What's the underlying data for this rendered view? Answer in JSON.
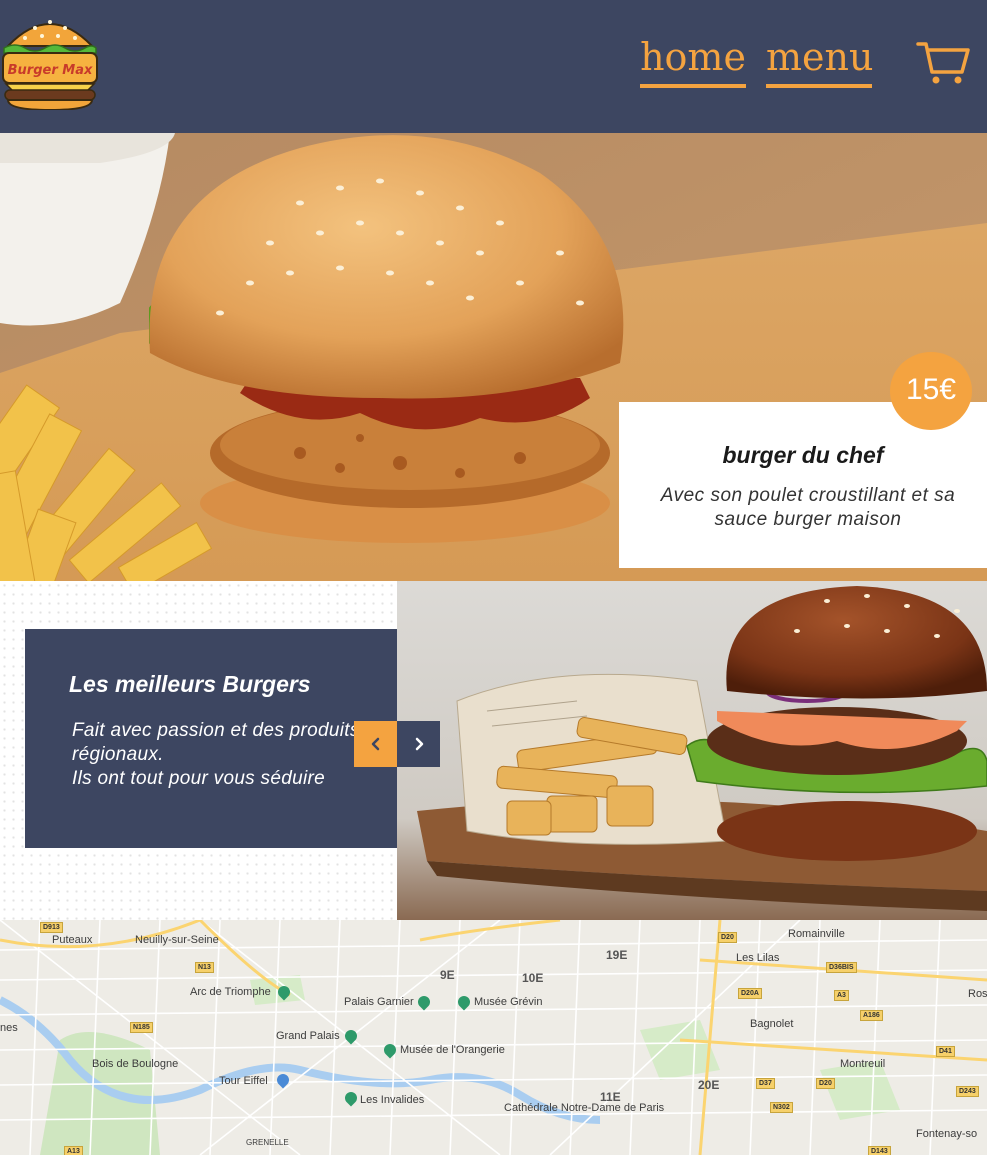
{
  "header": {
    "logo_text": "Burger Max",
    "nav": [
      {
        "label": "home"
      },
      {
        "label": "menu"
      }
    ]
  },
  "hero": {
    "price": "15€",
    "title": "burger du chef",
    "description": "Avec son poulet croustillant et sa sauce burger maison"
  },
  "feature": {
    "title": "Les meilleurs Burgers",
    "line1": "Fait avec passion et des produits régionaux.",
    "line2": "Ils ont tout pour vous séduire"
  },
  "map": {
    "places": [
      "Puteaux",
      "Neuilly-sur-Seine",
      "Arc de Triomphe",
      "Palais Garnier",
      "Musée Grévin",
      "Grand Palais",
      "Musée de l'Orangerie",
      "Bois de Boulogne",
      "Tour Eiffel",
      "Les Invalides",
      "Cathédrale Notre-Dame de Paris",
      "Les Lilas",
      "Romainville",
      "Bagnolet",
      "Montreuil",
      "Fontenay-so",
      "Ros",
      "nes",
      "GRENELLE"
    ],
    "districts": [
      "9E",
      "10E",
      "19E",
      "20E",
      "11E"
    ],
    "roads": [
      "D913",
      "N13",
      "N185",
      "D20",
      "D36BIS",
      "D20A",
      "A3",
      "A186",
      "D41",
      "D37",
      "D20",
      "N302",
      "D243",
      "A13",
      "D143"
    ]
  },
  "colors": {
    "header_bg": "#3d4661",
    "accent": "#f4a340"
  }
}
